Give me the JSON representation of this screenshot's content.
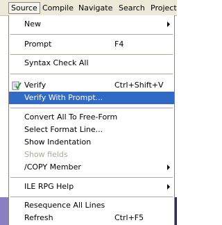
{
  "menubar": {
    "items": [
      "Source",
      "Compile",
      "Navigate",
      "Search",
      "Project"
    ]
  },
  "menu": {
    "items": [
      {
        "label": "New",
        "shortcut": "",
        "submenu": true
      },
      {
        "label": "Prompt",
        "shortcut": "F4"
      },
      {
        "label": "Syntax Check All",
        "shortcut": ""
      },
      {
        "label": "Verify",
        "shortcut": "Ctrl+Shift+V",
        "icon": "verify-check-icon"
      },
      {
        "label": "Verify With Prompt...",
        "shortcut": "",
        "selected": true
      },
      {
        "label": "Convert All To Free-Form",
        "shortcut": ""
      },
      {
        "label": "Select Format Line...",
        "shortcut": ""
      },
      {
        "label": "Show Indentation",
        "shortcut": ""
      },
      {
        "label": "Show fields",
        "shortcut": "",
        "disabled": true
      },
      {
        "label": "/COPY Member",
        "shortcut": "",
        "submenu": true
      },
      {
        "label": "ILE RPG Help",
        "shortcut": "",
        "submenu": true
      },
      {
        "label": "Resequence All Lines",
        "shortcut": ""
      },
      {
        "label": "Refresh",
        "shortcut": "Ctrl+F5"
      }
    ]
  },
  "colors": {
    "selection": "#316ac5",
    "menubar": "#ece9d8",
    "disabled_text": "#aca899"
  }
}
